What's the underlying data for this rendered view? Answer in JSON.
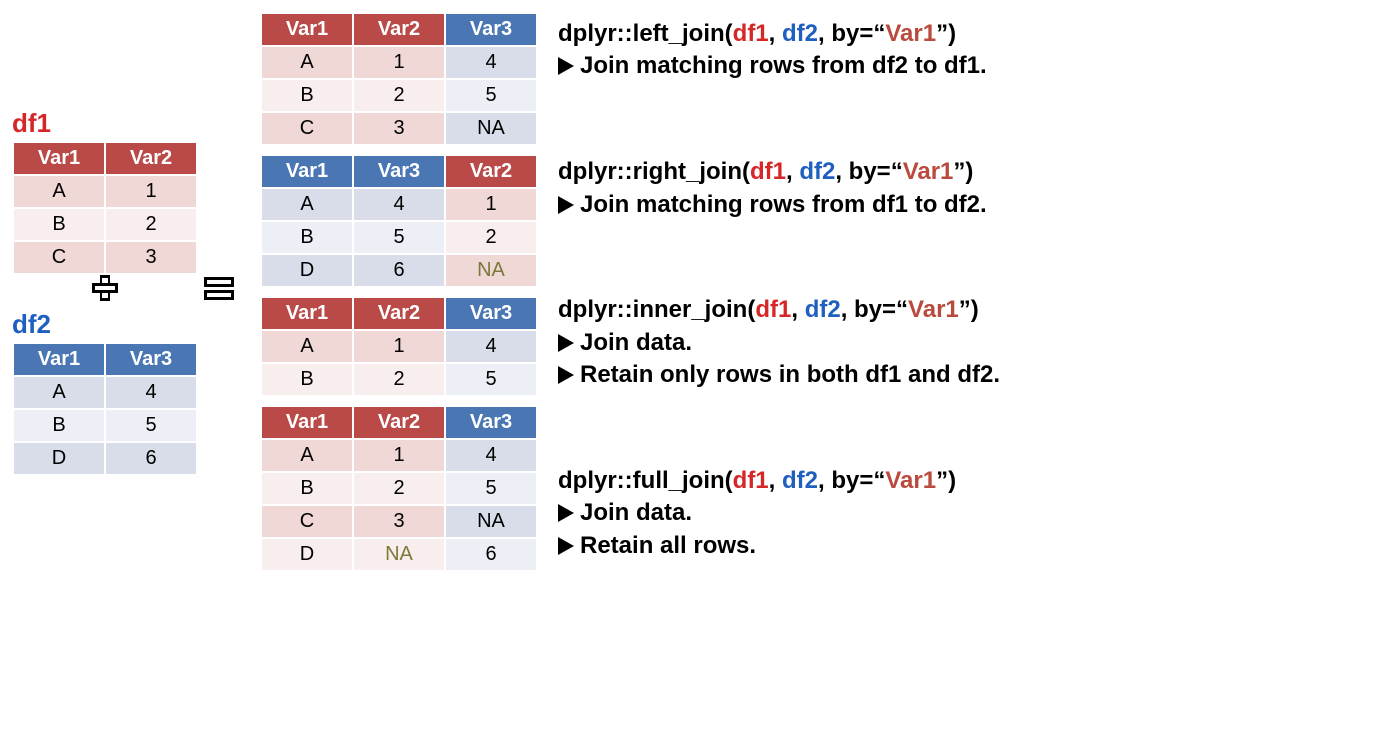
{
  "labels": {
    "df1": "df1",
    "df2": "df2"
  },
  "df1": {
    "headers": [
      "Var1",
      "Var2"
    ],
    "rows": [
      [
        "A",
        "1"
      ],
      [
        "B",
        "2"
      ],
      [
        "C",
        "3"
      ]
    ]
  },
  "df2": {
    "headers": [
      "Var1",
      "Var3"
    ],
    "rows": [
      [
        "A",
        "4"
      ],
      [
        "B",
        "5"
      ],
      [
        "D",
        "6"
      ]
    ]
  },
  "left_join": {
    "headers": [
      "Var1",
      "Var2",
      "Var3"
    ],
    "rows": [
      [
        "A",
        "1",
        "4"
      ],
      [
        "B",
        "2",
        "5"
      ],
      [
        "C",
        "3",
        "NA"
      ]
    ]
  },
  "right_join": {
    "headers": [
      "Var1",
      "Var3",
      "Var2"
    ],
    "rows": [
      [
        "A",
        "4",
        "1"
      ],
      [
        "B",
        "5",
        "2"
      ],
      [
        "D",
        "6",
        "NA"
      ]
    ]
  },
  "inner_join": {
    "headers": [
      "Var1",
      "Var2",
      "Var3"
    ],
    "rows": [
      [
        "A",
        "1",
        "4"
      ],
      [
        "B",
        "2",
        "5"
      ]
    ]
  },
  "full_join": {
    "headers": [
      "Var1",
      "Var2",
      "Var3"
    ],
    "rows": [
      [
        "A",
        "1",
        "4"
      ],
      [
        "B",
        "2",
        "5"
      ],
      [
        "C",
        "3",
        "NA"
      ],
      [
        "D",
        "NA",
        "6"
      ]
    ]
  },
  "text": {
    "lj_pre": "dplyr::left_join(",
    "rj_pre": "dplyr::right_join(",
    "ij_pre": "dplyr::inner_join(",
    "fj_pre": "dplyr::full_join(",
    "a1": "df1",
    "c1": ", ",
    "a2": "df2",
    "by_pre": ", by=“",
    "by_var": "Var1",
    "by_post": "”)",
    "lj_d1": "Join matching rows from df2 to df1.",
    "rj_d1": "Join matching rows from df1 to df2.",
    "ij_d1": "Join data.",
    "ij_d2": "Retain only rows in both df1 and df2.",
    "fj_d1": "Join data.",
    "fj_d2": "Retain all rows."
  }
}
